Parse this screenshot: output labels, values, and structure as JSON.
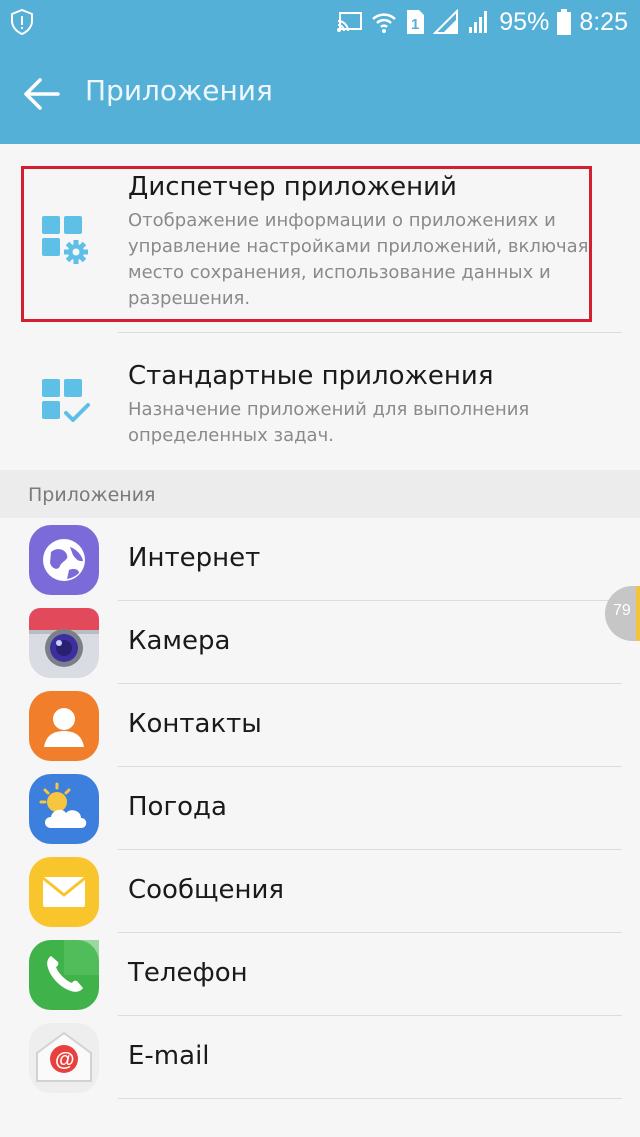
{
  "status_bar": {
    "battery_percent": "95%",
    "time": "8:25",
    "sim_label": "1",
    "icons": [
      "shield-icon",
      "cast-icon",
      "wifi-icon",
      "sim-icon",
      "signal-icon",
      "battery-icon"
    ]
  },
  "header": {
    "back_icon": "arrow-left-icon",
    "title": "Приложения"
  },
  "settings": [
    {
      "title": "Диспетчер приложений",
      "description": "Отображение информации о приложениях и управление настройками приложений, включая место сохранения, использование данных и разрешения.",
      "icon": "app-manager-gear-icon"
    },
    {
      "title": "Стандартные приложения",
      "description": "Назначение приложений для выполнения определенных задач.",
      "icon": "default-apps-check-icon"
    }
  ],
  "section": {
    "title": "Приложения"
  },
  "apps": [
    {
      "label": "Интернет",
      "icon": "internet-globe-icon"
    },
    {
      "label": "Камера",
      "icon": "camera-icon"
    },
    {
      "label": "Контакты",
      "icon": "contacts-icon"
    },
    {
      "label": "Погода",
      "icon": "weather-icon"
    },
    {
      "label": "Сообщения",
      "icon": "messages-icon"
    },
    {
      "label": "Телефон",
      "icon": "phone-icon"
    },
    {
      "label": "E-mail",
      "icon": "email-icon"
    }
  ],
  "scroll_index": {
    "label": "79"
  },
  "colors": {
    "accent": "#55b0d8",
    "highlight_border": "#d32030",
    "background": "#f6f6f6"
  }
}
